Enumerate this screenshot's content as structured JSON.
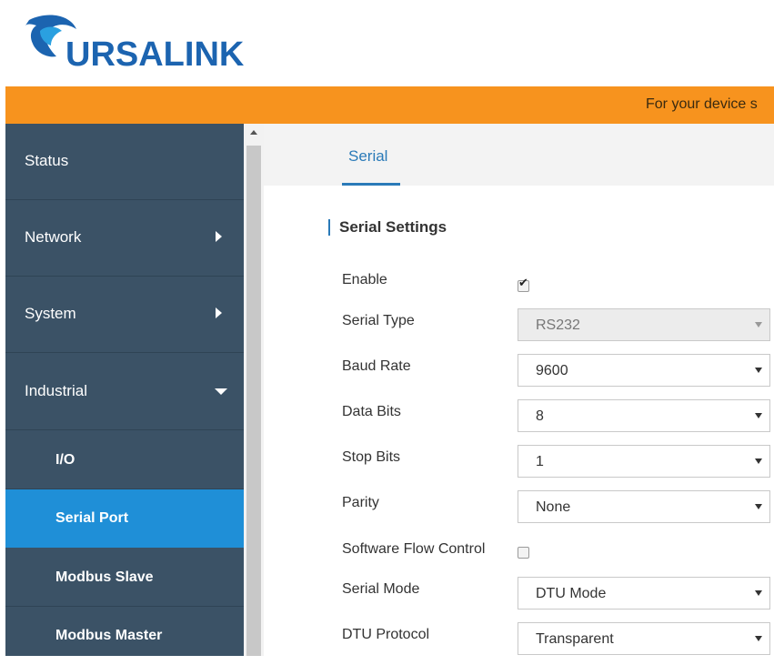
{
  "brand": {
    "name": "URSALINK",
    "logo_color": "#1c64b0"
  },
  "banner": {
    "text": "For your device s",
    "color": "#f7931e"
  },
  "sidebar": {
    "items": [
      {
        "label": "Status"
      },
      {
        "label": "Network",
        "icon": "chevron-right-icon"
      },
      {
        "label": "System",
        "icon": "chevron-right-icon"
      },
      {
        "label": "Industrial",
        "icon": "chevron-down-icon"
      }
    ],
    "subitems": [
      {
        "label": "I/O"
      },
      {
        "label": "Serial Port",
        "active": true
      },
      {
        "label": "Modbus Slave"
      },
      {
        "label": "Modbus Master"
      }
    ],
    "active_color": "#1f8fd7"
  },
  "tabs": [
    {
      "label": "Serial",
      "active": true
    }
  ],
  "section": {
    "title": "Serial Settings"
  },
  "form": {
    "enable": {
      "label": "Enable",
      "checked": true
    },
    "serial_type": {
      "label": "Serial Type",
      "value": "RS232",
      "disabled": true
    },
    "baud_rate": {
      "label": "Baud Rate",
      "value": "9600"
    },
    "data_bits": {
      "label": "Data Bits",
      "value": "8"
    },
    "stop_bits": {
      "label": "Stop Bits",
      "value": "1"
    },
    "parity": {
      "label": "Parity",
      "value": "None"
    },
    "software_flow_control": {
      "label": "Software Flow Control",
      "checked": false
    },
    "serial_mode": {
      "label": "Serial Mode",
      "value": "DTU Mode"
    },
    "dtu_protocol": {
      "label": "DTU Protocol",
      "value": "Transparent"
    }
  }
}
